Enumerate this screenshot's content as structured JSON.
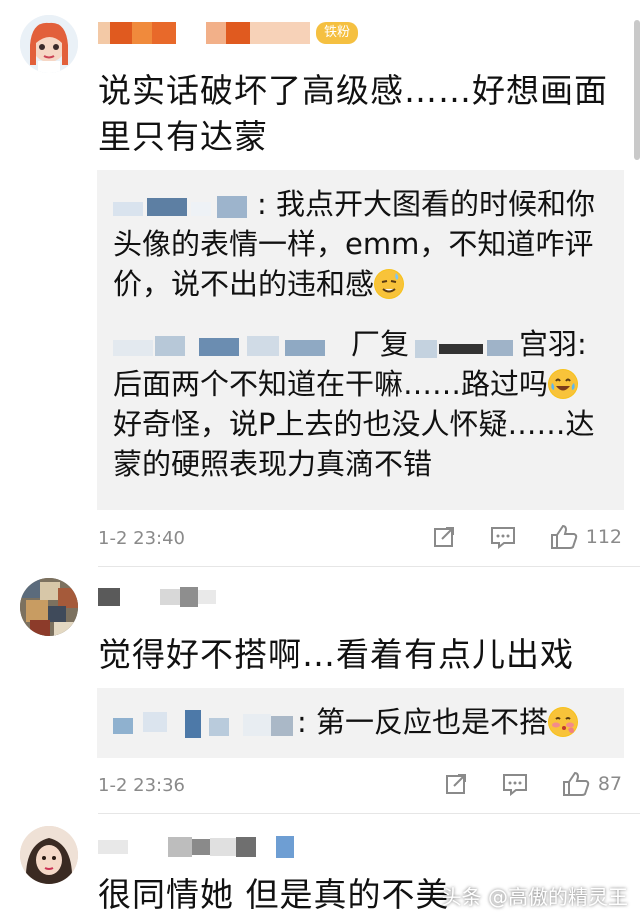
{
  "comments": [
    {
      "badge": "铁粉",
      "text": "说实话破坏了高级感……好想画面里只有达蒙",
      "replies": [
        {
          "suffix": ": 我点开大图看的时候和你头像的表情一样，emm，不知道咋评价，说不出的违和感"
        },
        {
          "middle": "厂复",
          "tail": "宫羽",
          "suffix": ":后面两个不知道在干嘛……路过吗",
          "suffix2": "好奇怪，说P上去的也没人怀疑……达蒙的硬照表现力真滴不错"
        }
      ],
      "time": "1-2 23:40",
      "likes": "112"
    },
    {
      "text": "觉得好不搭啊…看着有点儿出戏",
      "replies": [
        {
          "suffix": ": 第一反应也是不搭"
        }
      ],
      "time": "1-2 23:36",
      "likes": "87"
    },
    {
      "text": "很同情她 但是真的不美"
    }
  ],
  "watermark": "头条 @高傲的精灵王",
  "icons": [
    "share-icon",
    "comment-icon",
    "like-icon",
    "laugh-emoji",
    "cry-laugh-emoji",
    "blush-emoji",
    "sweat-emoji"
  ]
}
